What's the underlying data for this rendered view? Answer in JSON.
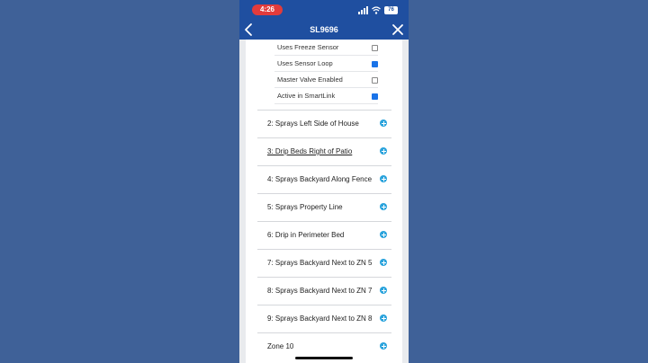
{
  "status_bar": {
    "time": "4:26",
    "battery": "76",
    "time_pill_color": "#e23b3b"
  },
  "nav": {
    "title": "SL9696",
    "back_icon": "chevron-left-icon",
    "close_icon": "close-icon"
  },
  "settings": [
    {
      "label": "Uses Freeze Sensor",
      "checked": false
    },
    {
      "label": "Uses Sensor Loop",
      "checked": true
    },
    {
      "label": "Master Valve Enabled",
      "checked": false
    },
    {
      "label": "Active in SmartLink",
      "checked": true
    }
  ],
  "zones": [
    {
      "label": "2: Sprays Left Side of House"
    },
    {
      "label": "3: Drip Beds Right of Patio"
    },
    {
      "label": "4: Sprays Backyard Along Fence"
    },
    {
      "label": "5: Sprays Property Line"
    },
    {
      "label": "6: Drip in Perimeter Bed"
    },
    {
      "label": "7: Sprays Backyard Next to ZN 5"
    },
    {
      "label": "8: Sprays Backyard Next to ZN 7"
    },
    {
      "label": "9: Sprays Backyard Next to ZN 8"
    },
    {
      "label": "Zone 10"
    }
  ],
  "colors": {
    "accent": "#2aa3dc",
    "header": "#1f4fa0",
    "background": "#3f6198"
  }
}
